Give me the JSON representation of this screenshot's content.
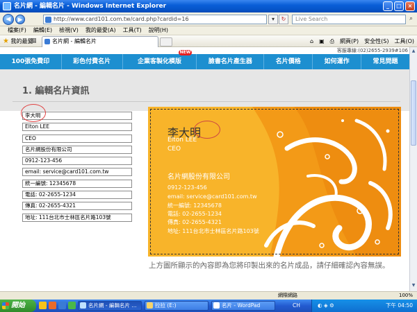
{
  "window": {
    "title": "名片網 - 編輯名片 - Windows Internet Explorer"
  },
  "address_bar": {
    "url": "http://www.card101.com.tw/card.php?cardid=16",
    "search_placeholder": "Live Search"
  },
  "menu": [
    "檔案(F)",
    "編輯(E)",
    "檢視(V)",
    "我的最愛(A)",
    "工具(T)",
    "說明(H)"
  ],
  "favorites_label": "我的最愛",
  "tab_label": "名片網 - 編輯名片",
  "command_bar": [
    "網頁(P)",
    "安全性(S)",
    "工具(O)"
  ],
  "site": {
    "hotline": "客服專線:(02)2655-2939#106",
    "nav": [
      "100張免費印",
      "彩色付費名片",
      "企業客製化模版",
      "臉書名片產生器",
      "名片價格",
      "如何運作",
      "常見問題"
    ],
    "new_badge": "NEW",
    "section_title": "1. 編輯名片資訊",
    "fields": [
      "李大明",
      "Elton LEE",
      "CEO",
      "名片網股份有限公司",
      "0912-123-456",
      "email: service@card101.com.tw",
      "統一編號: 12345678",
      "電話: 02-2655-1234",
      "傳真: 02-2655-4321",
      "地址: 111台北市士林區名片路103號"
    ],
    "card": {
      "name": "李大明",
      "english_name": "Elton LEE",
      "title": "CEO",
      "company": "名片網股份有限公司",
      "mobile": "0912-123-456",
      "email": "email: service@card101.com.tw",
      "tax_id": "統一編號: 12345678",
      "phone": "電話: 02-2655-1234",
      "fax": "傳真: 02-2655-4321",
      "address": "地址: 111台北市士林區名片路103號"
    },
    "notice": "上方圖所顯示的內容即為您將印製出來的名片成品，請仔細確認內容無誤。"
  },
  "status_bar": {
    "zone": "網際網路",
    "zoom": "100%"
  },
  "taskbar": {
    "start": "開始",
    "items": [
      "名片網 - 編輯名片 ...",
      "拉拉 (E:)",
      "名片 - WordPad"
    ],
    "ime": "CH",
    "clock": "下午 04:50"
  },
  "colors": {
    "nav_bar": "#1d8fd0",
    "card_orange": "#f8b42a",
    "card_dark_orange": "#f39a17",
    "title_bar": "#0553c7"
  }
}
